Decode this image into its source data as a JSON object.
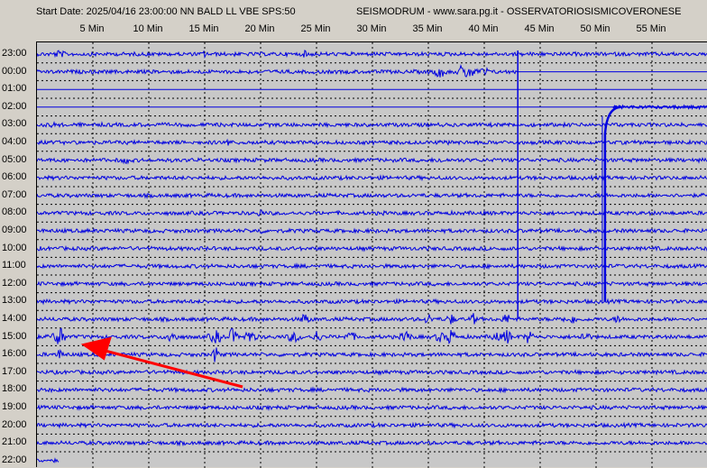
{
  "header": {
    "start_date": "Start Date: 2025/04/16 23:00:00 NN BALD LL VBE SPS:50",
    "title": "SEISMODRUM - www.sara.pg.it - OSSERVATORIOSISMICOVERONESE"
  },
  "minute_labels": [
    "5 Min",
    "10 Min",
    "15 Min",
    "20 Min",
    "25 Min",
    "30 Min",
    "35 Min",
    "40 Min",
    "45 Min",
    "50 Min",
    "55 Min"
  ],
  "hour_labels": [
    "23:00",
    "00:00",
    "01:00",
    "02:00",
    "03:00",
    "04:00",
    "05:00",
    "06:00",
    "07:00",
    "08:00",
    "09:00",
    "10:00",
    "11:00",
    "12:00",
    "13:00",
    "14:00",
    "15:00",
    "16:00",
    "17:00",
    "18:00",
    "19:00",
    "20:00",
    "21:00",
    "22:00"
  ],
  "colors": {
    "trace": "#0000e0",
    "background": "#c8c8c8",
    "grid": "#000000",
    "arrow": "#ff0000",
    "window": "#d4d0c8"
  },
  "annotation": {
    "type": "arrow",
    "points_to_hour": "15:00",
    "points_to_minute": 2
  }
}
